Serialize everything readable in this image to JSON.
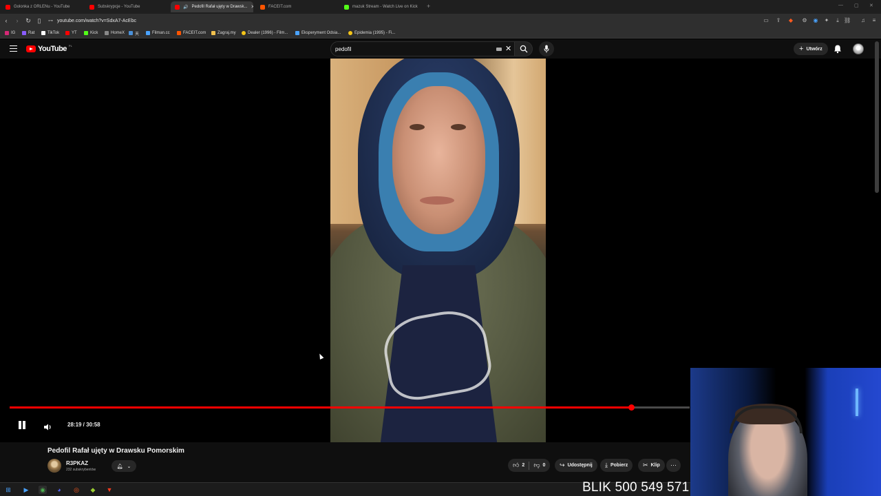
{
  "browser": {
    "tabs": [
      {
        "label": "Golonka z ORLENu - YouTube",
        "color": "#ff0000",
        "active": false
      },
      {
        "label": "Subskrypcje - YouTube",
        "color": "#ff0000",
        "active": false
      },
      {
        "label": "Pedofil Rafał ujęty w Drawsk...",
        "color": "#ff0000",
        "active": true
      },
      {
        "label": "FACEIT.com",
        "color": "#ff5500",
        "active": false
      },
      {
        "label": "mazuk Stream - Watch Live on Kick",
        "color": "#53fc18",
        "active": false
      }
    ],
    "url": "youtube.com/watch?v=SdxA7-AcEbc",
    "bookmarks": [
      {
        "label": "IG",
        "color": "#d62976"
      },
      {
        "label": "Rat",
        "color": "#8a5cff"
      },
      {
        "label": "TikTok",
        "color": "#ffffff"
      },
      {
        "label": "YT",
        "color": "#ff0000"
      },
      {
        "label": "Kick",
        "color": "#53fc18"
      },
      {
        "label": "Home",
        "color": "#888888"
      },
      {
        "label": "X",
        "color": "#ffffff"
      },
      {
        "label": "天",
        "color": "#4a90d9"
      },
      {
        "label": "Filman.cc",
        "color": "#4aa3ff"
      },
      {
        "label": "FACEIT.com",
        "color": "#ff5500"
      },
      {
        "label": "Zagraj.my",
        "color": "#f2c14e"
      },
      {
        "label": "Dealer (1996) - Film...",
        "color": "#f5c518"
      },
      {
        "label": "Eksperyment Odsia...",
        "color": "#4aa3ff"
      },
      {
        "label": "Epidemia (1995) - Fi...",
        "color": "#f5c518"
      }
    ]
  },
  "youtube": {
    "logo_text": "YouTube",
    "region": "PL",
    "search_value": "pedofil",
    "create_label": "Utwórz"
  },
  "player": {
    "time": "28:19 / 30:58",
    "progress_fraction": 0.914,
    "playing": true
  },
  "video": {
    "title": "Pedofil Rafał ujęty w Drawsku Pomorskim",
    "channel": "R3PKAZ",
    "subscribers": "232 subskrybentów",
    "likes": "2",
    "dislikes": "0",
    "share_label": "Udostępnij",
    "download_label": "Pobierz",
    "clip_label": "Klip"
  },
  "overlay": {
    "blik_text": "BLIK 500 549 571"
  },
  "colors": {
    "accent": "#ff0000",
    "background": "#0f0f0f"
  }
}
